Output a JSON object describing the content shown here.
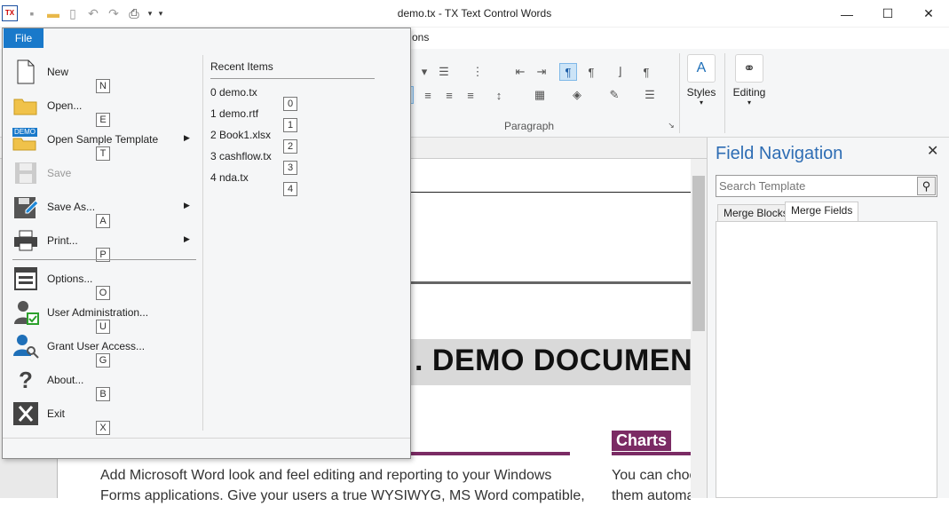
{
  "window": {
    "title": "demo.tx - TX Text Control Words",
    "app_icon_text": "TX",
    "minimize": "—",
    "maximize": "☐",
    "close": "✕"
  },
  "ribbon": {
    "visible_tab_fragment": "ons",
    "paragraph_group": "Paragraph",
    "styles_label": "Styles",
    "editing_label": "Editing"
  },
  "file_menu": {
    "tab_label": "File",
    "items": [
      {
        "label": "New",
        "key": "N",
        "icon": "new-document-icon"
      },
      {
        "label": "Open...",
        "key": "E",
        "icon": "open-folder-icon"
      },
      {
        "label": "Open Sample Template",
        "key": "T",
        "icon": "demo-template-icon"
      },
      {
        "label": "Save",
        "key": "",
        "icon": "save-icon"
      },
      {
        "label": "Save As...",
        "key": "A",
        "icon": "save-as-icon"
      },
      {
        "label": "Print...",
        "key": "P",
        "icon": "print-icon"
      },
      {
        "label": "Options...",
        "key": "O",
        "icon": "options-icon"
      },
      {
        "label": "User Administration...",
        "key": "U",
        "icon": "user-admin-icon"
      },
      {
        "label": "Grant User Access...",
        "key": "G",
        "icon": "grant-access-icon"
      },
      {
        "label": "About...",
        "key": "B",
        "icon": "help-icon"
      },
      {
        "label": "Exit",
        "key": "X",
        "icon": "exit-icon"
      }
    ],
    "demo_badge": "DEMO",
    "recent_title": "Recent Items",
    "recent": [
      {
        "label": "0 demo.tx",
        "key": "0"
      },
      {
        "label": "1 demo.rtf",
        "key": "1"
      },
      {
        "label": "2 Book1.xlsx",
        "key": "2"
      },
      {
        "label": "3 cashflow.tx",
        "key": "3"
      },
      {
        "label": "4 nda.tx",
        "key": "4"
      }
    ]
  },
  "document": {
    "heading": ". DEMO DOCUMEN",
    "charts_label": "Charts",
    "body_text": "Add Microsoft Word look and feel editing and reporting to your Windows",
    "body_text2": "Forms applications. Give your users a true WYSIWYG, MS Word compatible,",
    "side_text": "You can choo",
    "side_text2": "them automa"
  },
  "field_navigation": {
    "title": "Field Navigation",
    "search_placeholder": "Search Template",
    "tabs": [
      "Merge Blocks",
      "Merge Fields"
    ],
    "active_tab": "Merge Fields"
  },
  "colors": {
    "file_tab": "#1979ca",
    "accent_purple": "#7b2b64",
    "panel_title": "#2e6db4"
  }
}
